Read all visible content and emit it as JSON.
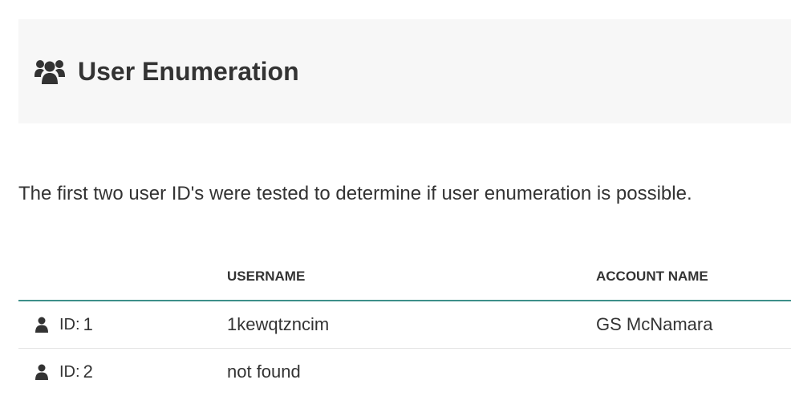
{
  "header": {
    "icon": "users-icon",
    "title": "User Enumeration"
  },
  "intro": {
    "text": "The first two user ID's were tested to determine if user enumeration is possible."
  },
  "table": {
    "columns": {
      "id": "",
      "username": "USERNAME",
      "account_name": "ACCOUNT NAME"
    },
    "rows": [
      {
        "icon": "user-icon",
        "id_label": "ID:",
        "id": "1",
        "username": "1kewqtzncim",
        "account_name": "GS McNamara"
      },
      {
        "icon": "user-icon",
        "id_label": "ID:",
        "id": "2",
        "username": "not found",
        "account_name": ""
      }
    ]
  },
  "colors": {
    "header_bg": "#f7f7f7",
    "text": "#333333",
    "table_header_rule": "#3d8f8a",
    "row_divider": "#e3e3e3"
  }
}
